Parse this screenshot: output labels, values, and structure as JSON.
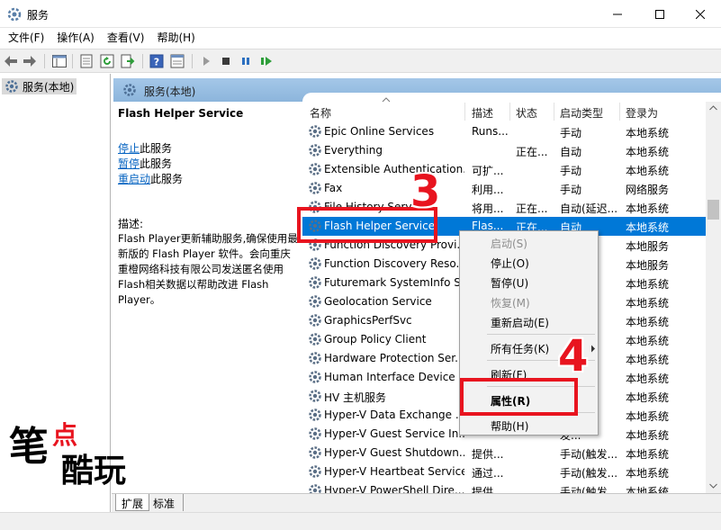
{
  "window": {
    "title": "服务"
  },
  "menubar": {
    "items": [
      "文件(F)",
      "操作(A)",
      "查看(V)",
      "帮助(H)"
    ]
  },
  "tree": {
    "root": "服务(本地)"
  },
  "pane": {
    "header": "服务(本地)"
  },
  "details": {
    "service_name": "Flash Helper Service",
    "stop_link": "停止",
    "stop_suffix": "此服务",
    "pause_link": "暂停",
    "pause_suffix": "此服务",
    "restart_link": "重启动",
    "restart_suffix": "此服务",
    "desc_label": "描述:",
    "desc_text": "Flash Player更新辅助服务,确保使用最新版的 Flash Player 软件。会向重庆重橙网络科技有限公司发送匿名使用Flash相关数据以帮助改进 Flash Player。"
  },
  "list": {
    "columns": {
      "name": "名称",
      "desc": "描述",
      "status": "状态",
      "type": "启动类型",
      "logon": "登录为"
    },
    "rows": [
      {
        "name": "Epic Online Services",
        "desc": "Runs...",
        "status": "",
        "type": "手动",
        "logon": "本地系统"
      },
      {
        "name": "Everything",
        "desc": "",
        "status": "正在...",
        "type": "自动",
        "logon": "本地系统"
      },
      {
        "name": "Extensible Authentication...",
        "desc": "可扩...",
        "status": "",
        "type": "手动",
        "logon": "本地系统"
      },
      {
        "name": "Fax",
        "desc": "利用...",
        "status": "",
        "type": "手动",
        "logon": "网络服务"
      },
      {
        "name": "File History Service",
        "desc": "将用...",
        "status": "正在...",
        "type": "自动(延迟...",
        "logon": "本地系统"
      },
      {
        "name": "Flash Helper Service",
        "desc": "Flas...",
        "status": "正在...",
        "type": "自动",
        "logon": "本地系统",
        "selected": true
      },
      {
        "name": "Function Discovery Provi...",
        "desc": "",
        "status": "",
        "type": "",
        "logon": "本地服务"
      },
      {
        "name": "Function Discovery Reso...",
        "desc": "",
        "status": "",
        "type": "发...",
        "logon": "本地服务"
      },
      {
        "name": "Futuremark SystemInfo S...",
        "desc": "",
        "status": "",
        "type": "",
        "logon": "本地系统"
      },
      {
        "name": "Geolocation Service",
        "desc": "",
        "status": "",
        "type": "发...",
        "logon": "本地系统"
      },
      {
        "name": "GraphicsPerfSvc",
        "desc": "",
        "status": "",
        "type": "发...",
        "logon": "本地系统"
      },
      {
        "name": "Group Policy Client",
        "desc": "",
        "status": "",
        "type": "",
        "logon": "本地系统"
      },
      {
        "name": "Hardware Protection Ser...",
        "desc": "",
        "status": "",
        "type": "",
        "logon": "本地系统"
      },
      {
        "name": "Human Interface Device ...",
        "desc": "",
        "status": "",
        "type": "",
        "logon": "本地系统"
      },
      {
        "name": "HV 主机服务",
        "desc": "",
        "status": "",
        "type": "",
        "logon": "本地系统"
      },
      {
        "name": "Hyper-V Data Exchange ...",
        "desc": "",
        "status": "",
        "type": "",
        "logon": "本地系统"
      },
      {
        "name": "Hyper-V Guest Service In...",
        "desc": "",
        "status": "",
        "type": "发...",
        "logon": "本地系统"
      },
      {
        "name": "Hyper-V Guest Shutdown...",
        "desc": "提供...",
        "status": "",
        "type": "手动(触发...",
        "logon": "本地系统"
      },
      {
        "name": "Hyper-V Heartbeat Service",
        "desc": "通过...",
        "status": "",
        "type": "手动(触发...",
        "logon": "本地系统"
      },
      {
        "name": "Hyper-V PowerShell Dire...",
        "desc": "提供...",
        "status": "",
        "type": "手动(触发...",
        "logon": "本地系统"
      }
    ]
  },
  "context_menu": {
    "start": "启动(S)",
    "stop": "停止(O)",
    "pause": "暂停(U)",
    "resume": "恢复(M)",
    "restart": "重新启动(E)",
    "all_tasks": "所有任务(K)",
    "refresh": "刷新(F)",
    "properties": "属性(R)",
    "help": "帮助(H)"
  },
  "annotations": {
    "step3": "3",
    "step4": "4"
  },
  "tabs": {
    "extended": "扩展",
    "standard": "标准"
  },
  "watermark": {
    "c1": "笔",
    "c2": "点",
    "c3": "酷玩"
  },
  "colors": {
    "selection": "#0078d7",
    "highlight": "#e8141f",
    "link": "#0563c1"
  },
  "icons": [
    "services-icon",
    "gear-icon",
    "back-icon",
    "forward-icon",
    "play-icon",
    "stop-icon",
    "pause-icon",
    "resume-icon"
  ]
}
